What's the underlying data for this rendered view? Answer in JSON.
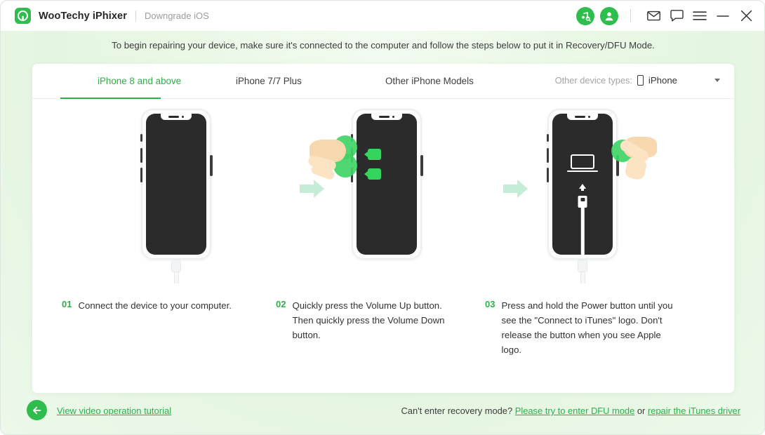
{
  "titlebar": {
    "logo_icon": "wootechy-p-logo-icon",
    "app_title": "WooTechy iPhixer",
    "subtitle": "Downgrade iOS",
    "actions": [
      {
        "icon": "itunes-music-search-icon",
        "name": "itunes-helper-button"
      },
      {
        "icon": "user-account-icon",
        "name": "account-button"
      },
      {
        "icon": "envelope-icon",
        "name": "mail-button"
      },
      {
        "icon": "chat-bubble-icon",
        "name": "feedback-button"
      },
      {
        "icon": "hamburger-menu-icon",
        "name": "menu-button"
      },
      {
        "icon": "minimize-icon",
        "name": "minimize-button"
      },
      {
        "icon": "close-icon",
        "name": "close-button"
      }
    ]
  },
  "banner": {
    "text": "To begin repairing your device, make sure it's connected to the computer and follow the steps below to put it in Recovery/DFU Mode."
  },
  "tabs": [
    {
      "label": "iPhone 8 and above",
      "active": true
    },
    {
      "label": "iPhone 7/7 Plus",
      "active": false
    },
    {
      "label": "Other iPhone Models",
      "active": false
    }
  ],
  "device_type": {
    "label": "Other device types:",
    "icon": "phone-outline-icon",
    "value": "iPhone",
    "caret_icon": "chevron-down-icon"
  },
  "steps": [
    {
      "num": "01",
      "text": "Connect the device to your computer.",
      "illustration": "iphone-connected-to-computer"
    },
    {
      "num": "02",
      "text": "Quickly press the Volume Up button. Then quickly press the Volume Down button.",
      "illustration": "iphone-volume-buttons-pressed"
    },
    {
      "num": "03",
      "text": "Press and hold the Power button until you see the \"Connect to iTunes\" logo. Don't release the button when you see Apple logo.",
      "illustration": "iphone-recovery-mode-screen"
    }
  ],
  "footer": {
    "back_icon": "arrow-left-icon",
    "video_link": "View video operation tutorial",
    "help_prefix": "Can't enter recovery mode?",
    "dfu_link": "Please try to enter DFU mode",
    "help_middle": "or",
    "driver_link": "repair the iTunes driver"
  },
  "colors": {
    "brand_green": "#2fbd4d",
    "tab_green": "#2fae4a",
    "arrow_mint": "#c4ecd6",
    "bg_green": "#e8f7e4",
    "screen_dark": "#2b2b2b"
  }
}
